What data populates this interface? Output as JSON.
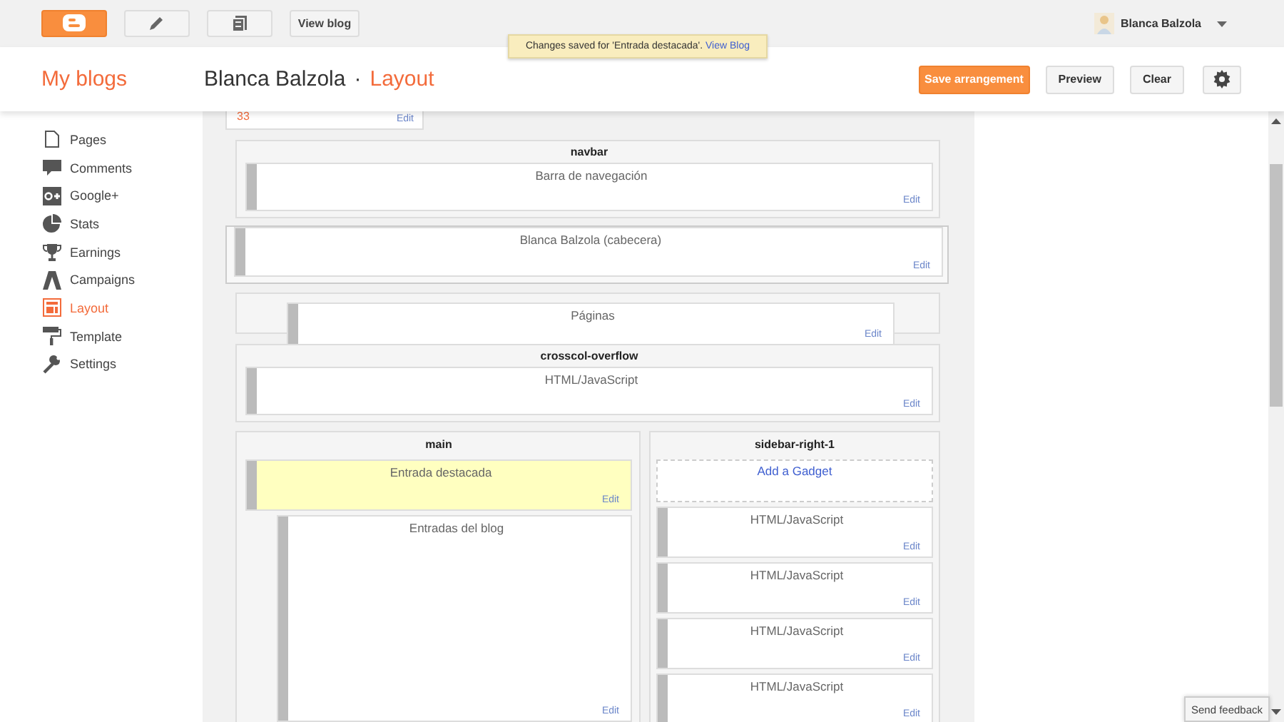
{
  "topbar": {
    "view_blog": "View blog",
    "user": {
      "name": "Blanca Balzola"
    }
  },
  "toast": {
    "message": "Changes saved for 'Entrada destacada'.",
    "link": "View Blog"
  },
  "header": {
    "my_blogs": "My blogs",
    "blog_title": "Blanca Balzola",
    "separator": "·",
    "page": "Layout",
    "buttons": [
      {
        "label": "Save arrangement",
        "kind": "primary"
      },
      {
        "label": "Preview",
        "kind": "default"
      },
      {
        "label": "Clear",
        "kind": "default"
      }
    ]
  },
  "sidebar": {
    "items": [
      {
        "label": "Pages",
        "selected": false
      },
      {
        "label": "Comments",
        "selected": false
      },
      {
        "label": "Google+",
        "selected": false
      },
      {
        "label": "Stats",
        "selected": false
      },
      {
        "label": "Earnings",
        "selected": false
      },
      {
        "label": "Campaigns",
        "selected": false
      },
      {
        "label": "Layout",
        "selected": true
      },
      {
        "label": "Template",
        "selected": false
      },
      {
        "label": "Settings",
        "selected": false
      }
    ]
  },
  "canvas": {
    "cut_widget": {
      "count": "33",
      "edit": "Edit"
    },
    "rows": [
      {
        "kind": "section",
        "title": "navbar",
        "widget": {
          "title": "Barra de navegación",
          "edit": "Edit"
        }
      },
      {
        "kind": "floating",
        "widget": {
          "title": "Blanca Balzola (cabecera)",
          "edit": "Edit"
        }
      },
      {
        "kind": "covered",
        "widget": {
          "title": "Páginas",
          "edit": "Edit"
        }
      },
      {
        "kind": "section",
        "title": "crosscol-overflow",
        "widget": {
          "title": "HTML/JavaScript",
          "edit": "Edit"
        }
      }
    ],
    "columns": [
      {
        "title": "main",
        "widgets": [
          {
            "kind": "normal",
            "title": "Entrada destacada",
            "edit": "Edit",
            "highlighted": true
          },
          {
            "kind": "tall",
            "title": "Entradas del blog",
            "edit": "Edit",
            "highlighted": false
          }
        ]
      },
      {
        "title": "sidebar-right-1",
        "add_gadget": "Add a Gadget",
        "widgets": [
          {
            "kind": "normal",
            "title": "HTML/JavaScript",
            "edit": "Edit",
            "highlighted": false
          },
          {
            "kind": "normal",
            "title": "HTML/JavaScript",
            "edit": "Edit",
            "highlighted": false
          },
          {
            "kind": "normal",
            "title": "HTML/JavaScript",
            "edit": "Edit",
            "highlighted": false
          },
          {
            "kind": "normal",
            "title": "HTML/JavaScript",
            "edit": "Edit",
            "highlighted": false
          }
        ]
      }
    ]
  },
  "feedback": {
    "label": "Send feedback"
  }
}
